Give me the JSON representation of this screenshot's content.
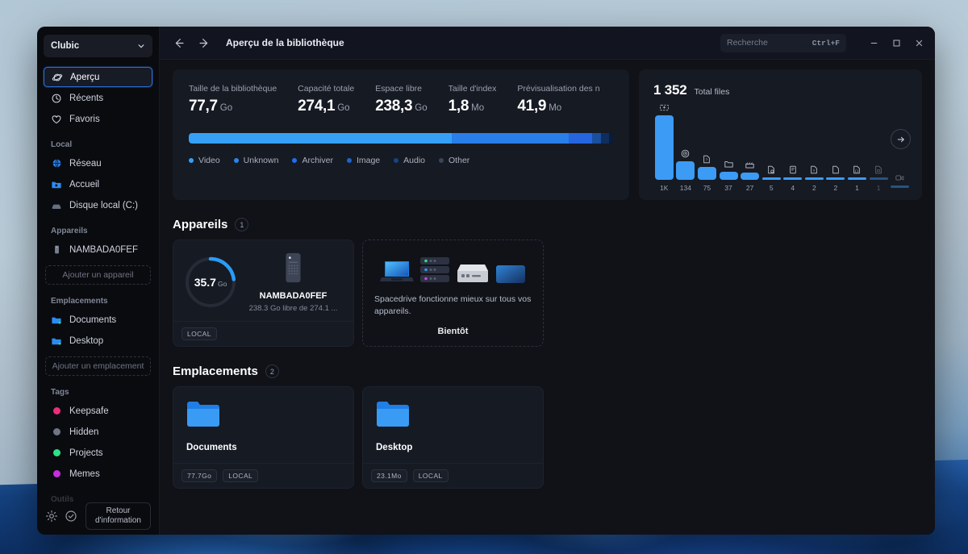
{
  "window": {
    "title": "Aperçu de la bibliothèque",
    "library_name": "Clubic",
    "search": {
      "placeholder": "Recherche",
      "shortcut": "Ctrl+F"
    },
    "controls": {
      "minimize": "—",
      "maximize": "□",
      "close": "✕"
    },
    "nav": {
      "back": "←",
      "forward": "→"
    }
  },
  "sidebar": {
    "main_items": [
      {
        "label": "Aperçu",
        "icon": "planet-icon",
        "active": true
      },
      {
        "label": "Récents",
        "icon": "clock-icon",
        "active": false
      },
      {
        "label": "Favoris",
        "icon": "heart-icon",
        "active": false
      }
    ],
    "sections": [
      {
        "label": "Local",
        "items": [
          {
            "label": "Réseau",
            "icon": "globe-icon",
            "color": "#2b7fe0"
          },
          {
            "label": "Accueil",
            "icon": "folder-home-icon",
            "color": "#2b8cf0"
          },
          {
            "label": "Disque local (C:)",
            "icon": "drive-icon",
            "color": "#6b7488"
          }
        ]
      },
      {
        "label": "Appareils",
        "items": [
          {
            "label": "NAMBADA0FEF",
            "icon": "device-icon",
            "color": "#8b93a4"
          }
        ],
        "add_label": "Ajouter un appareil"
      },
      {
        "label": "Emplacements",
        "items": [
          {
            "label": "Documents",
            "icon": "folder-icon",
            "color": "#2b8cf0"
          },
          {
            "label": "Desktop",
            "icon": "folder-icon",
            "color": "#2b8cf0"
          }
        ],
        "add_label": "Ajouter un emplacement"
      },
      {
        "label": "Tags",
        "items": [
          {
            "label": "Keepsafe",
            "icon": "tag-dot-icon",
            "color": "#ec2d7b"
          },
          {
            "label": "Hidden",
            "icon": "tag-dot-icon",
            "color": "#6e7585"
          },
          {
            "label": "Projects",
            "icon": "tag-dot-icon",
            "color": "#2de08a"
          },
          {
            "label": "Memes",
            "icon": "tag-dot-icon",
            "color": "#c82de0"
          }
        ]
      },
      {
        "label": "Outils",
        "items": []
      }
    ],
    "footer": {
      "settings_icon": "gear-icon",
      "sync_icon": "check-circle-icon",
      "feedback_line1": "Retour",
      "feedback_line2": "d'information"
    }
  },
  "stats": [
    {
      "label": "Taille de la bibliothèque",
      "value": "77,7",
      "unit": "Go"
    },
    {
      "label": "Capacité totale",
      "value": "274,1",
      "unit": "Go"
    },
    {
      "label": "Espace libre",
      "value": "238,3",
      "unit": "Go"
    },
    {
      "label": "Taille d'index",
      "value": "1,8",
      "unit": "Mo"
    },
    {
      "label": "Prévisualisation des n",
      "value": "41,9",
      "unit": "Mo"
    }
  ],
  "usage_bar": {
    "segments": [
      {
        "label": "Video",
        "pct": 62.0,
        "color": "#36a0f7"
      },
      {
        "label": "Unknown",
        "pct": 27.5,
        "color": "#2a7ee8"
      },
      {
        "label": "Archiver",
        "pct": 5.6,
        "color": "#2565e0"
      },
      {
        "label": "Image",
        "pct": 2.0,
        "color": "#1a4f9e"
      },
      {
        "label": "Audio",
        "pct": 1.9,
        "color": "#0f2e5e"
      },
      {
        "label": "Other",
        "pct": 1.0,
        "color": "#0b1c38"
      }
    ],
    "legend": [
      {
        "label": "Video",
        "color": "#36a0f7"
      },
      {
        "label": "Unknown",
        "color": "#2a85ee"
      },
      {
        "label": "Archiver",
        "color": "#1f6ef0"
      },
      {
        "label": "Image",
        "color": "#1f63cf"
      },
      {
        "label": "Audio",
        "color": "#17447f"
      },
      {
        "label": "Other",
        "color": "#3b4558"
      }
    ]
  },
  "chart_data": {
    "type": "bar",
    "title": "Total files",
    "total_label": "1 352",
    "categories": [
      "Video",
      "Audio",
      "Unknown",
      "Folder",
      "Archiver",
      "Config",
      "Document",
      "Text",
      "Document2",
      "Code",
      "Encrypted",
      "Screenshot"
    ],
    "tick_labels": [
      "1K",
      "134",
      "75",
      "37",
      "27",
      "5",
      "4",
      "2",
      "2",
      "1",
      "1",
      ""
    ],
    "values": [
      1000,
      134,
      75,
      37,
      27,
      5,
      4,
      2,
      2,
      1,
      1,
      1
    ],
    "icons": [
      "video-file-icon",
      "audio-disc-icon",
      "unknown-file-icon",
      "folder-icon",
      "clapperboard-icon",
      "config-file-icon",
      "document-icon",
      "keyfile-icon",
      "blank-file-icon",
      "code-file-icon",
      "encrypted-file-icon",
      "screenshot-icon"
    ],
    "bar_color": "#3b9bf5",
    "ylim": [
      0,
      1000
    ],
    "xlabel": "",
    "ylabel": "",
    "grid": false,
    "legend": "none",
    "next_arrow": "→"
  },
  "devices_section": {
    "title": "Appareils",
    "count": "1",
    "device": {
      "ring_value": "35.7",
      "ring_unit": "Go",
      "ring_pct": 23,
      "ring_color": "#2b9bf5",
      "name": "NAMBADA0FEF",
      "subtitle": "238.3 Go libre de 274.1 ...",
      "badge": "LOCAL"
    },
    "promo": {
      "text": "Spacedrive fonctionne mieux sur tous vos appareils.",
      "cta": "Bientôt"
    }
  },
  "locations_section": {
    "title": "Emplacements",
    "count": "2",
    "items": [
      {
        "name": "Documents",
        "size": "77.7Go",
        "badge": "LOCAL"
      },
      {
        "name": "Desktop",
        "size": "23.1Mo",
        "badge": "LOCAL"
      }
    ]
  }
}
